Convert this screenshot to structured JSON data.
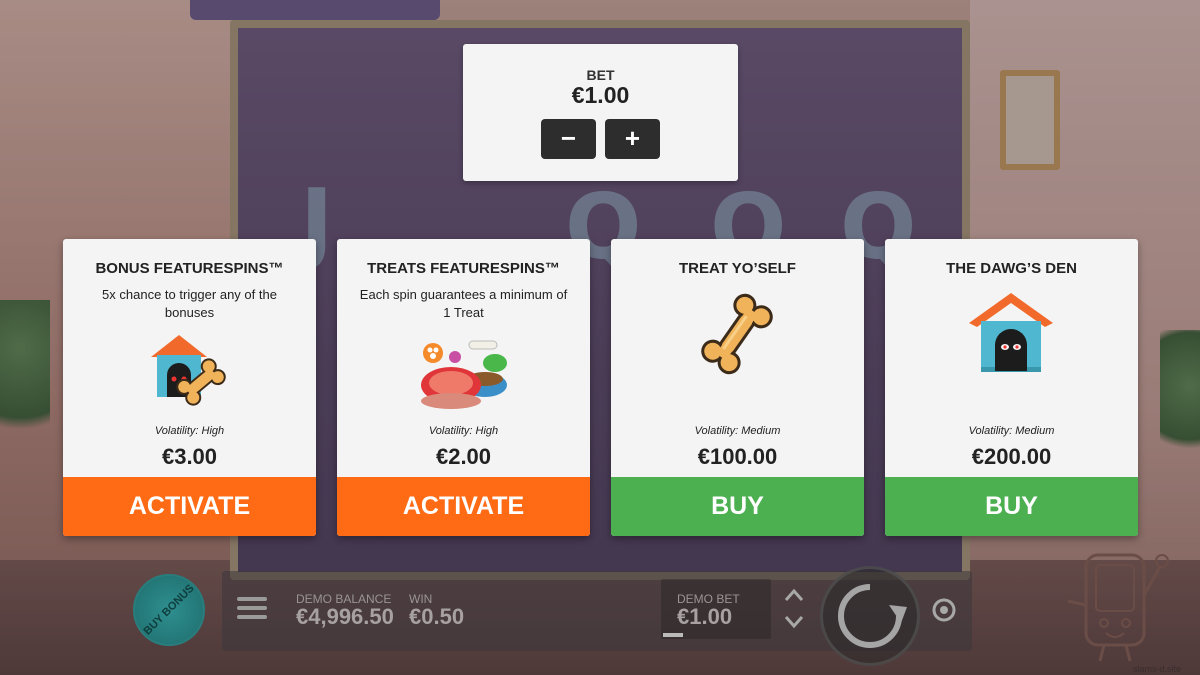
{
  "bet_panel": {
    "label": "BET",
    "value": "€1.00",
    "minus_label": "−",
    "plus_label": "+"
  },
  "cards": [
    {
      "title": "BONUS FEATURESPINS™",
      "description": "5x chance to trigger any of the bonuses",
      "icon": "doghouse-and-bone-icon",
      "volatility": "Volatility: High",
      "price": "€3.00",
      "button_label": "ACTIVATE",
      "button_color": "#ff6a14"
    },
    {
      "title": "TREATS FEATURESPINS™",
      "description": "Each spin guarantees a minimum of 1 Treat",
      "icon": "treats-bowl-icon",
      "volatility": "Volatility: High",
      "price": "€2.00",
      "button_label": "ACTIVATE",
      "button_color": "#ff6a14"
    },
    {
      "title": "TREAT YO’SELF",
      "description": "",
      "icon": "bone-icon",
      "volatility": "Volatility: Medium",
      "price": "€100.00",
      "button_label": "BUY",
      "button_color": "#4caf50"
    },
    {
      "title": "THE DAWG’S DEN",
      "description": "",
      "icon": "doghouse-icon",
      "volatility": "Volatility: Medium",
      "price": "€200.00",
      "button_label": "BUY",
      "button_color": "#4caf50"
    }
  ],
  "bottom_bar": {
    "buy_bonus_label": "BUY BONUS",
    "demo_balance_label": "DEMO BALANCE",
    "demo_balance_value": "€4,996.50",
    "win_label": "WIN",
    "win_value": "€0.50",
    "demo_bet_label": "DEMO BET",
    "demo_bet_value": "€1.00"
  },
  "watermark": "slams-d.site",
  "colors": {
    "activate": "#ff6a14",
    "buy": "#4caf50",
    "buy_bonus": "#2f8f8f"
  }
}
